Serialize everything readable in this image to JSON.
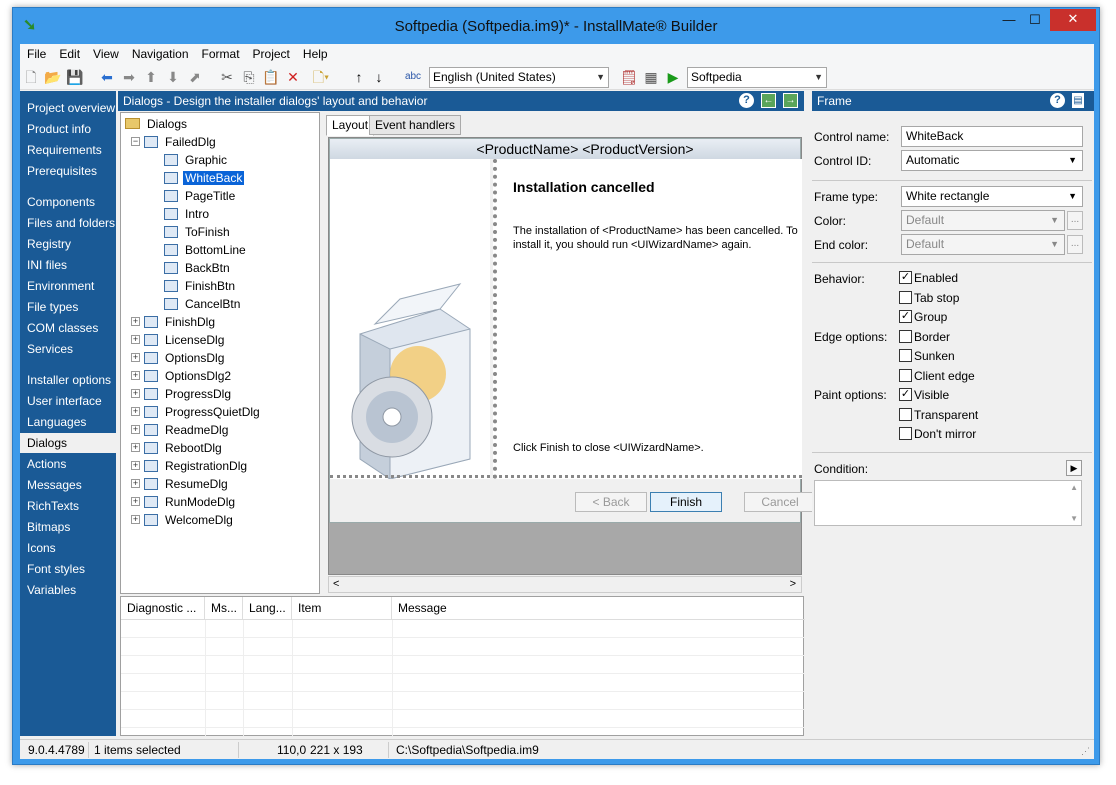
{
  "window": {
    "title": "Softpedia (Softpedia.im9)* - InstallMate® Builder",
    "min": "—",
    "max": "☐",
    "close": "✕"
  },
  "menu": [
    "File",
    "Edit",
    "View",
    "Navigation",
    "Format",
    "Project",
    "Help"
  ],
  "toolbar": {
    "language": "English (United States)",
    "project": "Softpedia"
  },
  "nav": {
    "items": [
      "Project overview",
      "Product info",
      "Requirements",
      "Prerequisites",
      "Components",
      "Files and folders",
      "Registry",
      "INI files",
      "Environment",
      "File types",
      "COM classes",
      "Services",
      "Installer options",
      "User interface",
      "Languages",
      "Dialogs",
      "Actions",
      "Messages",
      "RichTexts",
      "Bitmaps",
      "Icons",
      "Font styles",
      "Variables"
    ],
    "selected": "Dialogs"
  },
  "dialogs_panel": {
    "header": "Dialogs - Design the installer dialogs' layout and behavior"
  },
  "tree": {
    "root": "Dialogs",
    "expanded": "FailedDlg",
    "children": [
      "Graphic",
      "WhiteBack",
      "PageTitle",
      "Intro",
      "ToFinish",
      "BottomLine",
      "BackBtn",
      "FinishBtn",
      "CancelBtn"
    ],
    "selected": "WhiteBack",
    "others": [
      "FinishDlg",
      "LicenseDlg",
      "OptionsDlg",
      "OptionsDlg2",
      "ProgressDlg",
      "ProgressQuietDlg",
      "ReadmeDlg",
      "RebootDlg",
      "RegistrationDlg",
      "ResumeDlg",
      "RunModeDlg",
      "WelcomeDlg"
    ]
  },
  "editor": {
    "tabs": [
      "Layout",
      "Event handlers"
    ],
    "active_tab": "Layout",
    "dialog": {
      "title": "<ProductName> <ProductVersion>",
      "heading": "Installation cancelled",
      "body": "The installation of <ProductName> has been cancelled. To install it, you should run <UIWizardName> again.",
      "footer": "Click Finish to close <UIWizardName>.",
      "buttons": {
        "back": "< Back",
        "finish": "Finish",
        "cancel": "Cancel"
      }
    }
  },
  "props": {
    "header": "Frame",
    "control_name_label": "Control name:",
    "control_name": "WhiteBack",
    "control_id_label": "Control ID:",
    "control_id": "Automatic",
    "frame_type_label": "Frame type:",
    "frame_type": "White rectangle",
    "color_label": "Color:",
    "color": "Default",
    "end_color_label": "End color:",
    "end_color": "Default",
    "more": "...",
    "behavior_label": "Behavior:",
    "edge_label": "Edge options:",
    "paint_label": "Paint options:",
    "checks": [
      {
        "label": "Enabled",
        "checked": true
      },
      {
        "label": "Tab stop",
        "checked": false
      },
      {
        "label": "Group",
        "checked": true
      },
      {
        "label": "Border",
        "checked": false
      },
      {
        "label": "Sunken",
        "checked": false
      },
      {
        "label": "Client edge",
        "checked": false
      },
      {
        "label": "Visible",
        "checked": true
      },
      {
        "label": "Transparent",
        "checked": false
      },
      {
        "label": "Don't mirror",
        "checked": false
      }
    ],
    "condition_label": "Condition:"
  },
  "diagnostics": {
    "columns": [
      "Diagnostic ...",
      "Ms...",
      "Lang...",
      "Item",
      "Message"
    ]
  },
  "status": {
    "version": "9.0.4.4789",
    "selection": "1 items selected",
    "position": "110,0",
    "size": "221 x 193",
    "path": "C:\\Softpedia\\Softpedia.im9"
  },
  "colors": {
    "nav_bg": "#1a5a96",
    "frame": "#3d9aea",
    "selection": "#0a64d8"
  }
}
